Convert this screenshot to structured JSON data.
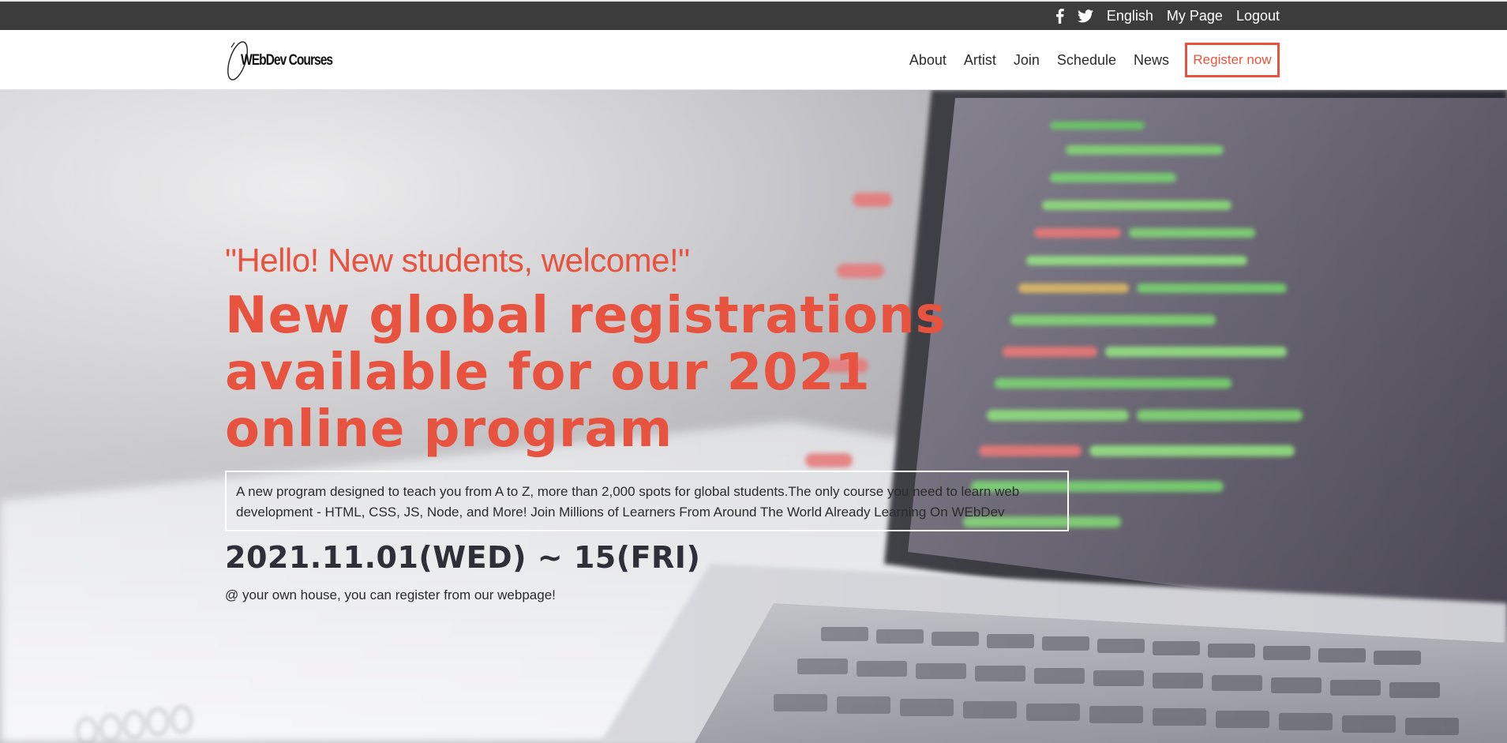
{
  "topbar": {
    "social": [
      {
        "icon": "facebook-icon"
      },
      {
        "icon": "twitter-icon"
      }
    ],
    "links": [
      "English",
      "My Page",
      "Logout"
    ]
  },
  "navbar": {
    "logo_text": "WEbDev Courses",
    "links": [
      "About",
      "Artist",
      "Join",
      "Schedule",
      "News"
    ],
    "register_label": "Register now"
  },
  "hero": {
    "subtitle": "\"Hello! New students, welcome!\"",
    "title": "New global registrations available for our 2021 online program",
    "description": "A new program designed to teach you from A to Z, more than 2,000 spots for global students.The only course you need to learn web development - HTML, CSS, JS, Node, and More! Join Millions of Learners From Around The World Already Learning On WEbDev",
    "date": "2021.11.01(WED) ~ 15(FRI)",
    "place": "@ your own house, you can register from our webpage!"
  },
  "colors": {
    "accent": "#e7533f",
    "topbar_bg": "#3c3c3c",
    "date_text": "#2f2f3a"
  }
}
